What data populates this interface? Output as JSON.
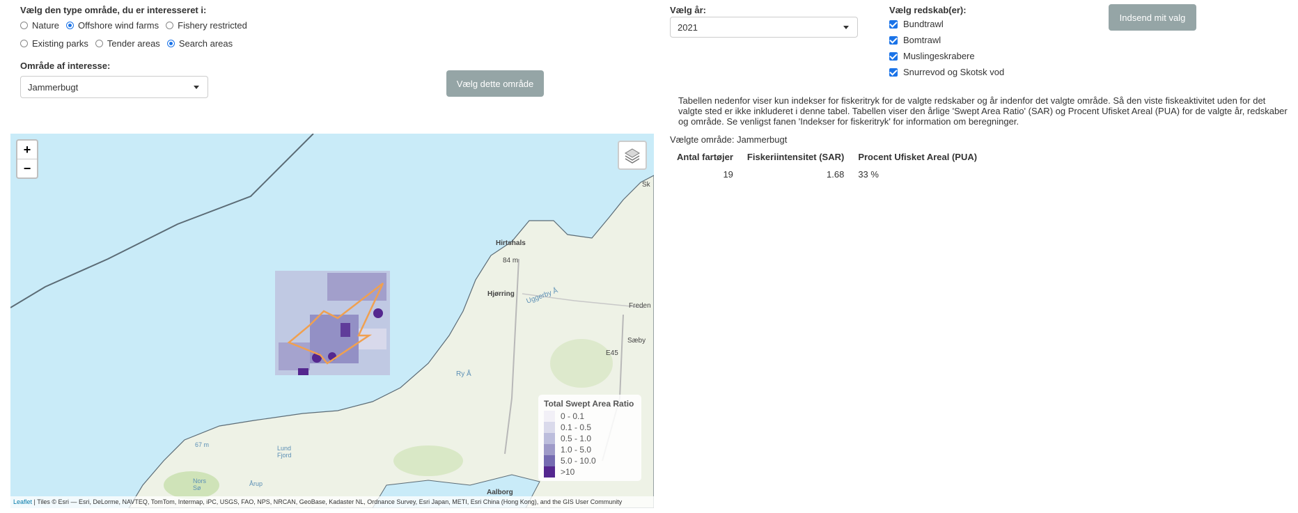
{
  "area_type": {
    "label": "Vælg den type område, du er interesseret i:",
    "options": [
      {
        "label": "Nature",
        "checked": false
      },
      {
        "label": "Offshore wind farms",
        "checked": true
      },
      {
        "label": "Fishery restricted",
        "checked": false
      },
      {
        "label": "Existing parks",
        "checked": false
      },
      {
        "label": "Tender areas",
        "checked": false
      },
      {
        "label": "Search areas",
        "checked": true
      }
    ]
  },
  "area_of_interest": {
    "label": "Område af interesse:",
    "selected": "Jammerbugt",
    "button_label": "Vælg dette område"
  },
  "year": {
    "label": "Vælg år:",
    "selected": "2021"
  },
  "gear": {
    "label": "Vælg redskab(er):",
    "options": [
      {
        "label": "Bundtrawl",
        "checked": true
      },
      {
        "label": "Bomtrawl",
        "checked": true
      },
      {
        "label": "Muslingeskrabere",
        "checked": true
      },
      {
        "label": "Snurrevod og Skotsk vod",
        "checked": true
      }
    ]
  },
  "submit_label": "Indsend mit valg",
  "info": {
    "description": "Tabellen nedenfor viser kun indekser for fiskeritryk for de valgte redskaber og år indenfor det valgte område. Så den viste fiskeaktivitet uden for det valgte sted er ikke inkluderet i denne tabel. Tabellen viser den årlige 'Swept Area Ratio' (SAR) og Procent Ufisket Areal (PUA) for de valgte år, redskaber og område. Se venligst fanen 'Indekser for fiskeritryk' for information om beregninger.",
    "selected_area": "Vælgte område: Jammerbugt"
  },
  "table": {
    "headers": [
      "Antal fartøjer",
      "Fiskeriintensitet (SAR)",
      "Procent Ufisket Areal (PUA)"
    ],
    "rows": [
      [
        "19",
        "1.68",
        "33 %"
      ]
    ]
  },
  "map": {
    "zoom_in": "+",
    "zoom_out": "−",
    "legend": {
      "title": "Total Swept Area Ratio",
      "items": [
        {
          "label": "0 - 0.1",
          "color": "#f2f0f7"
        },
        {
          "label": "0.1 - 0.5",
          "color": "#dadaeb"
        },
        {
          "label": "0.5 - 1.0",
          "color": "#bcbddc"
        },
        {
          "label": "1.0 - 5.0",
          "color": "#9e9ac8"
        },
        {
          "label": "5.0 - 10.0",
          "color": "#756bb1"
        },
        {
          "label": ">10",
          "color": "#54278f"
        }
      ]
    },
    "labels": {
      "hirtshals": "Hirtshals",
      "hjorring": "Hjørring",
      "frederikshavn": "Freden",
      "saeby": "Sæby",
      "aalborg": "Aalborg",
      "lund_fjord": "Lund\nFjord",
      "uggerby": "Uggerby Å",
      "ryea": "Ry Å",
      "depth84": "84 m",
      "depth67": "67 m",
      "sk": "Sk",
      "e45": "E45",
      "nors": "Nors\nSø",
      "arup": "Årup"
    },
    "attribution_link": "Leaflet",
    "attribution_text": " | Tiles © Esri — Esri, DeLorme, NAVTEQ, TomTom, Intermap, iPC, USGS, FAO, NPS, NRCAN, GeoBase, Kadaster NL, Ordnance Survey, Esri Japan, METI, Esri China (Hong Kong), and the GIS User Community"
  }
}
